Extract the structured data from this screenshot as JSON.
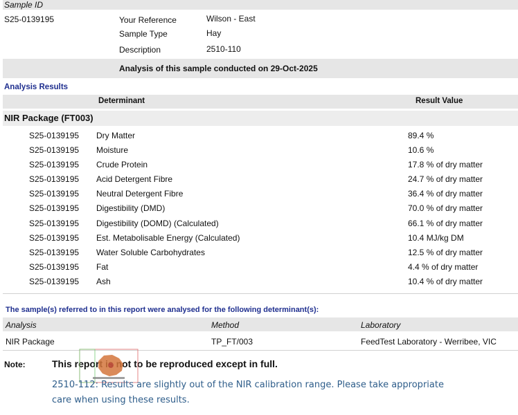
{
  "sample": {
    "header_label": "Sample ID",
    "id": "S25-0139195",
    "fields": [
      {
        "label": "Your Reference",
        "value": "Wilson - East"
      },
      {
        "label": "Sample Type",
        "value": "Hay"
      },
      {
        "label": "Description",
        "value": "2510-110"
      }
    ],
    "conducted": "Analysis of this sample conducted on 29-Oct-2025"
  },
  "results": {
    "section_title": "Analysis Results",
    "col_determinant": "Determinant",
    "col_result": "Result Value",
    "package": "NIR Package  (FT003)",
    "rows": [
      {
        "id": "S25-0139195",
        "determinant": "Dry Matter",
        "value": "89.4 %"
      },
      {
        "id": "S25-0139195",
        "determinant": "Moisture",
        "value": "10.6 %"
      },
      {
        "id": "S25-0139195",
        "determinant": "Crude Protein",
        "value": "17.8 % of dry matter"
      },
      {
        "id": "S25-0139195",
        "determinant": "Acid Detergent Fibre",
        "value": "24.7 % of dry matter"
      },
      {
        "id": "S25-0139195",
        "determinant": "Neutral Detergent Fibre",
        "value": "36.4 % of dry matter"
      },
      {
        "id": "S25-0139195",
        "determinant": "Digestibility (DMD)",
        "value": "70.0 % of dry matter"
      },
      {
        "id": "S25-0139195",
        "determinant": "Digestibility (DOMD) (Calculated)",
        "value": "66.1 % of dry matter"
      },
      {
        "id": "S25-0139195",
        "determinant": "Est. Metabolisable Energy (Calculated)",
        "value": "10.4 MJ/kg DM"
      },
      {
        "id": "S25-0139195",
        "determinant": "Water Soluble Carbohydrates",
        "value": "12.5 % of dry matter"
      },
      {
        "id": "S25-0139195",
        "determinant": "Fat",
        "value": "4.4 % of dry matter"
      },
      {
        "id": "S25-0139195",
        "determinant": "Ash",
        "value": "10.4 % of dry matter"
      }
    ]
  },
  "methods": {
    "title": "The sample(s) referred to in this report were analysed for the following determinant(s):",
    "col_analysis": "Analysis",
    "col_method": "Method",
    "col_laboratory": "Laboratory",
    "row": {
      "analysis": "NIR Package",
      "method": "TP_FT/003",
      "laboratory": "FeedTest Laboratory - Werribee, VIC"
    }
  },
  "note": {
    "label": "Note:",
    "text": "This report is not to be reproduced except in full.",
    "comment_line1": "2510-112: Results are slightly out of the NIR calibration range. Please take appropriate",
    "comment_line2": "care when using these results."
  },
  "colors": {
    "section_blue": "#1f2f8f",
    "comment_blue": "#2e5d8a",
    "band_grey": "#e6e6e6"
  }
}
